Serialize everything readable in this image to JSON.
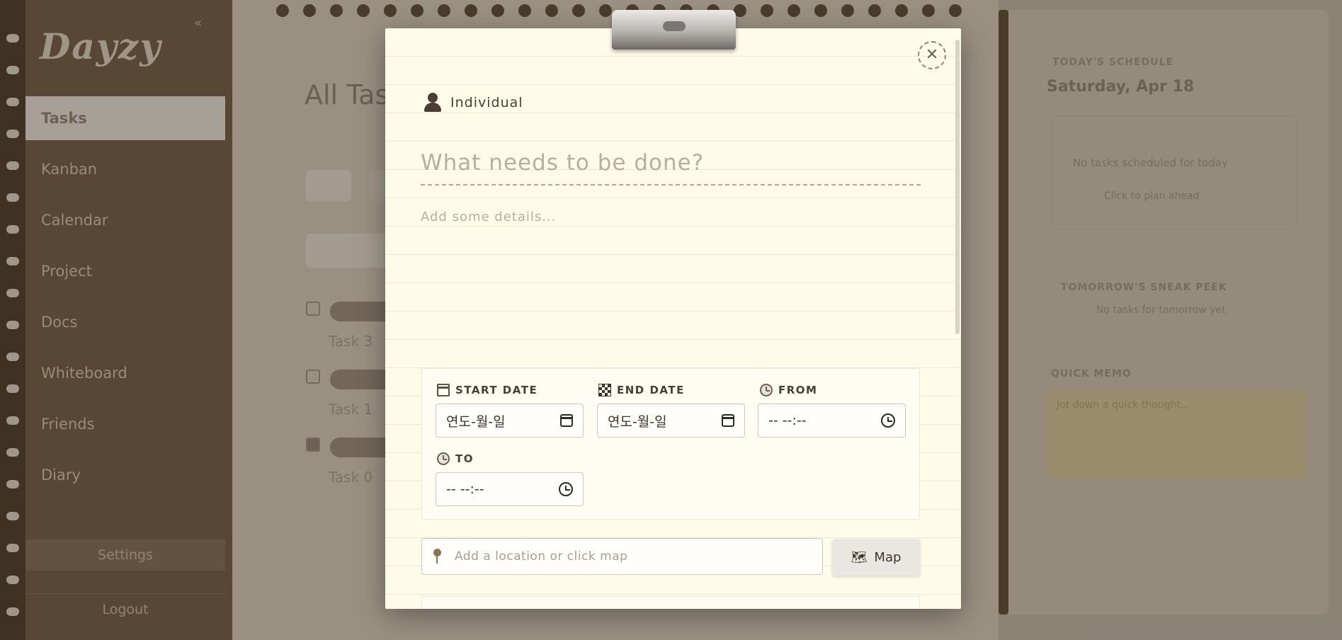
{
  "sidebar": {
    "logo": "Dayzy",
    "collapse_label": "«",
    "items": [
      {
        "label": "Tasks",
        "active": true
      },
      {
        "label": "Kanban"
      },
      {
        "label": "Calendar"
      },
      {
        "label": "Project"
      },
      {
        "label": "Docs"
      },
      {
        "label": "Whiteboard"
      },
      {
        "label": "Friends"
      },
      {
        "label": "Diary"
      }
    ],
    "settings_label": "Settings",
    "logout_label": "Logout"
  },
  "main": {
    "title": "All Tasks",
    "tasks": [
      {
        "name": "Task 3"
      },
      {
        "name": "Task 1"
      },
      {
        "name": "Task 0"
      }
    ]
  },
  "right_panel": {
    "schedule_label": "TODAY'S SCHEDULE",
    "date": "Saturday, Apr 18",
    "no_tasks": "No tasks scheduled for today",
    "plan_ahead": "Click to plan ahead",
    "tomorrow_label": "TOMORROW'S SNEAK PEEK",
    "tomorrow_empty": "No tasks for tomorrow yet",
    "memo_label": "QUICK MEMO",
    "memo_placeholder": "Jot down a quick thought..."
  },
  "modal": {
    "close_symbol": "✕",
    "type_label": "Individual",
    "title_placeholder": "What needs to be done?",
    "details_placeholder": "Add some details...",
    "start_date_label": "START DATE",
    "end_date_label": "END DATE",
    "from_label": "FROM",
    "to_label": "TO",
    "date_placeholder": "연도-월-일",
    "time_placeholder": "-- --:--",
    "location_placeholder": "Add a location or click map",
    "map_label": "Map",
    "map_icon": "🗺"
  },
  "colors": {
    "paper": "#fffbe9",
    "sidebar": "#6e5a45",
    "accent_brown": "#4a3d33"
  }
}
